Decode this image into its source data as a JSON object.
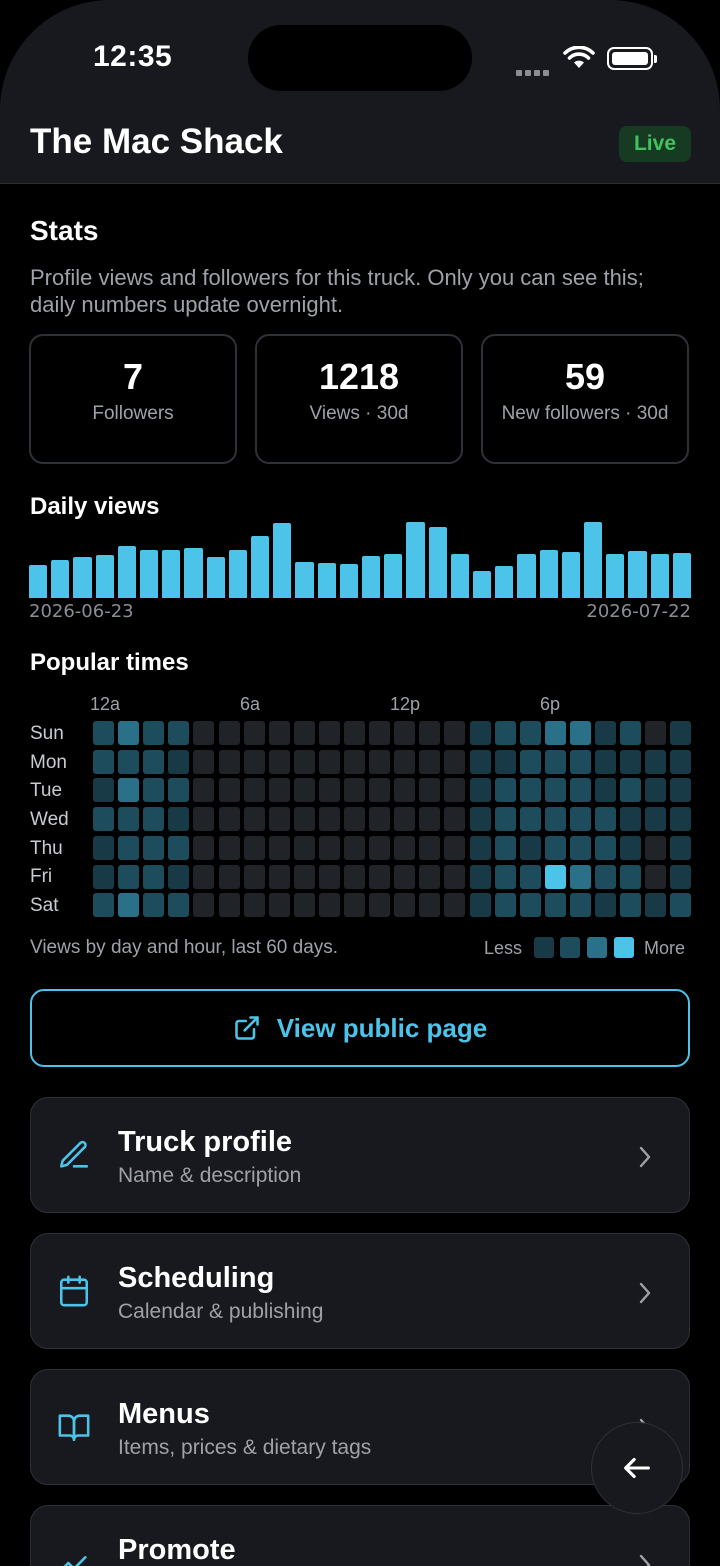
{
  "status_bar": {
    "time": "12:35"
  },
  "header": {
    "title": "The Mac Shack",
    "badge": "Live"
  },
  "stats": {
    "title": "Stats",
    "description": "Profile views and followers for this truck. Only you can see this; daily numbers update overnight.",
    "cards": [
      {
        "value": "7",
        "label": "Followers"
      },
      {
        "value": "1218",
        "label": "Views · 30d"
      },
      {
        "value": "59",
        "label": "New followers · 30d"
      }
    ]
  },
  "daily_views": {
    "title": "Daily views",
    "start_date": "2026-06-23",
    "end_date": "2026-07-22"
  },
  "chart_data": {
    "type": "bar",
    "title": "Daily views",
    "x_range": [
      "2026-06-23",
      "2026-07-22"
    ],
    "values": [
      42,
      49,
      53,
      55,
      67,
      61,
      62,
      64,
      52,
      62,
      79,
      96,
      46,
      45,
      43,
      54,
      56,
      97,
      91,
      57,
      35,
      41,
      57,
      61,
      59,
      98,
      57,
      60,
      56,
      58
    ],
    "color": "#4cc3e8"
  },
  "popular_times": {
    "title": "Popular times",
    "hour_labels": [
      "12a",
      "6a",
      "12p",
      "6p"
    ],
    "days": [
      "Sun",
      "Mon",
      "Tue",
      "Wed",
      "Thu",
      "Fri",
      "Sat"
    ],
    "levels": [
      [
        2,
        3,
        2,
        2,
        0,
        0,
        0,
        0,
        0,
        0,
        0,
        0,
        0,
        0,
        0,
        1,
        2,
        2,
        3,
        3,
        1,
        2,
        0,
        1
      ],
      [
        2,
        2,
        2,
        1,
        0,
        0,
        0,
        0,
        0,
        0,
        0,
        0,
        0,
        0,
        0,
        1,
        1,
        2,
        2,
        2,
        1,
        1,
        1,
        1
      ],
      [
        1,
        3,
        2,
        2,
        0,
        0,
        0,
        0,
        0,
        0,
        0,
        0,
        0,
        0,
        0,
        1,
        2,
        2,
        2,
        2,
        1,
        2,
        1,
        1
      ],
      [
        2,
        2,
        2,
        1,
        0,
        0,
        0,
        0,
        0,
        0,
        0,
        0,
        0,
        0,
        0,
        1,
        2,
        2,
        2,
        2,
        2,
        1,
        1,
        1
      ],
      [
        1,
        2,
        2,
        2,
        0,
        0,
        0,
        0,
        0,
        0,
        0,
        0,
        0,
        0,
        0,
        1,
        2,
        1,
        2,
        2,
        2,
        1,
        0,
        1
      ],
      [
        1,
        2,
        2,
        1,
        0,
        0,
        0,
        0,
        0,
        0,
        0,
        0,
        0,
        0,
        0,
        1,
        2,
        2,
        4,
        3,
        2,
        2,
        0,
        1
      ],
      [
        2,
        3,
        2,
        2,
        0,
        0,
        0,
        0,
        0,
        0,
        0,
        0,
        0,
        0,
        0,
        1,
        2,
        2,
        2,
        2,
        1,
        2,
        1,
        2
      ]
    ],
    "level_colors": [
      "#202328",
      "#183a47",
      "#1d4c5d",
      "#2a7088",
      "#4cc3e8"
    ],
    "caption": "Views by day and hour, last 60 days.",
    "legend_less": "Less",
    "legend_more": "More"
  },
  "view_public_page": {
    "label": "View public page",
    "icon": "external-link-icon"
  },
  "menu": [
    {
      "title": "Truck profile",
      "subtitle": "Name & description",
      "icon": "pencil-icon"
    },
    {
      "title": "Scheduling",
      "subtitle": "Calendar & publishing",
      "icon": "calendar-icon"
    },
    {
      "title": "Menus",
      "subtitle": "Items, prices & dietary tags",
      "icon": "book-icon"
    },
    {
      "title": "Promote",
      "subtitle": "",
      "icon": "trending-icon"
    }
  ],
  "accent": "#4cc3e8"
}
